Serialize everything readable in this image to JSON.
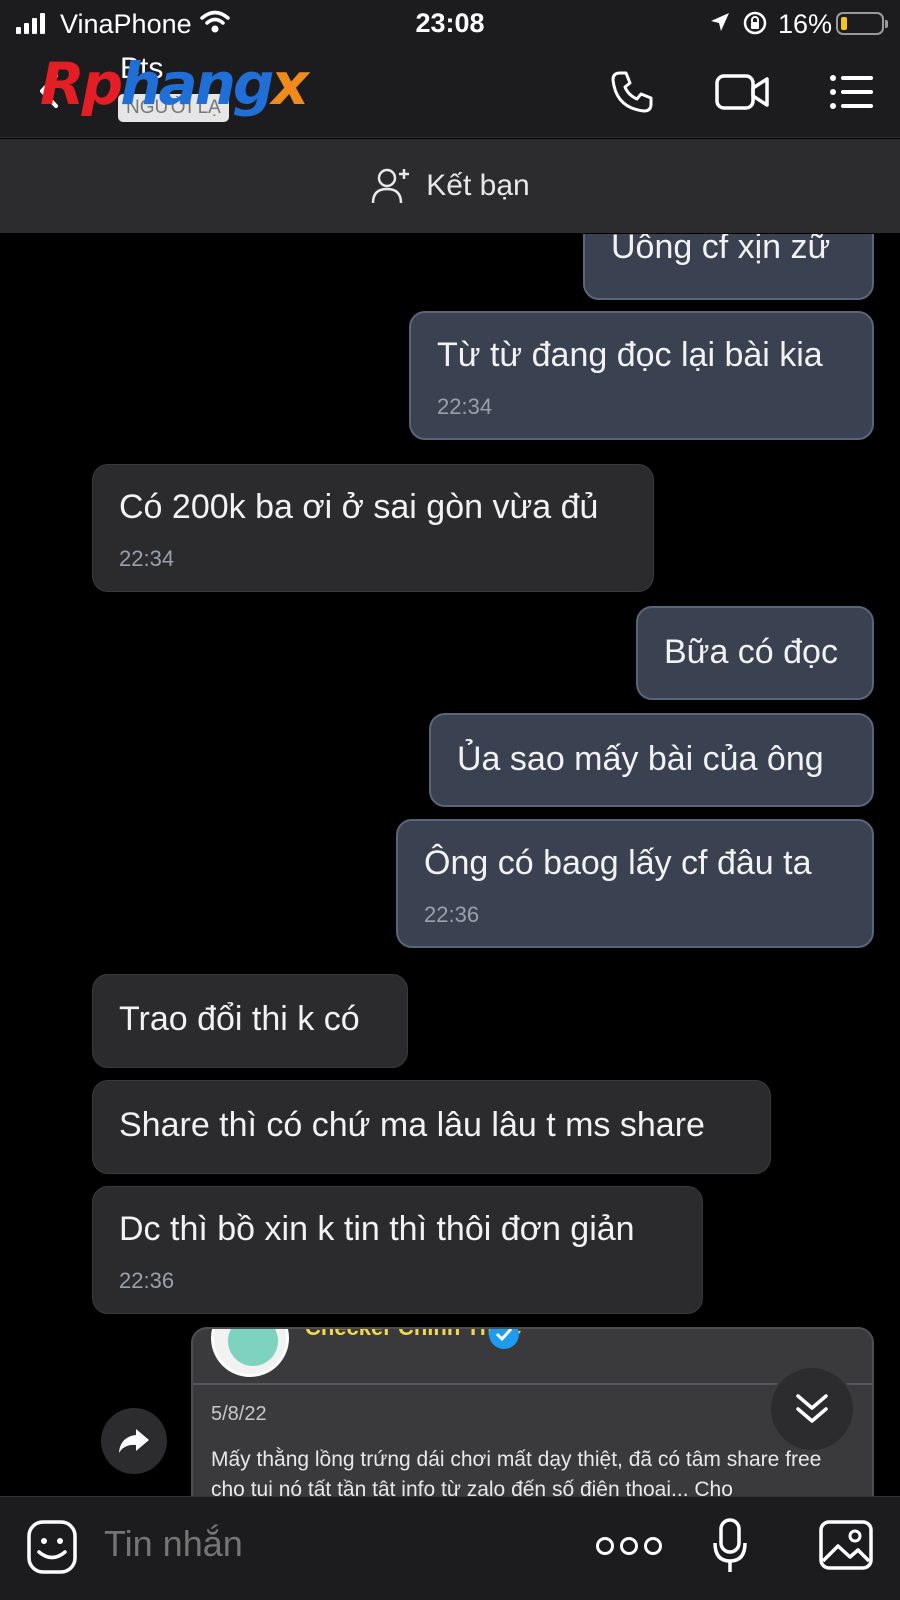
{
  "status_bar": {
    "carrier": "VinaPhone",
    "time": "23:08",
    "battery_percent": "16%",
    "battery_level": 0.16,
    "battery_color": "#f5c518"
  },
  "header": {
    "contact_name": "Bts",
    "stranger_badge": "NGƯỜI LẠ",
    "watermark": {
      "part1": "Rp",
      "part2": "hang",
      "part3": "x"
    },
    "icons": [
      "back-icon",
      "phone-icon",
      "video-call-icon",
      "menu-list-icon"
    ]
  },
  "add_friend": {
    "label": "Kết bạn",
    "icon": "add-friend-icon"
  },
  "messages": [
    {
      "direction": "out",
      "text": "Uông cf xịn zữ",
      "time": ""
    },
    {
      "direction": "out",
      "text": "Từ từ đang đọc lại bài kia",
      "time": "22:34"
    },
    {
      "direction": "in",
      "text": "Có 200k ba ơi ở sai gòn vừa đủ",
      "time": "22:34"
    },
    {
      "direction": "out",
      "text": "Bữa có đọc",
      "time": ""
    },
    {
      "direction": "out",
      "text": "Ủa sao mấy bài của ông",
      "time": ""
    },
    {
      "direction": "out",
      "text": "Ông có baog lấy cf đâu ta",
      "time": "22:36"
    },
    {
      "direction": "in",
      "text": "Trao đổi thi k có",
      "time": ""
    },
    {
      "direction": "in",
      "text": "Share thì có chứ ma lâu lâu t ms share",
      "time": ""
    },
    {
      "direction": "in",
      "text": "Dc thì bồ xin k tin thì thôi đơn giản",
      "time": "22:36"
    }
  ],
  "shared_post": {
    "page_name": "Checker Chính Thức",
    "date": "5/8/22",
    "content": "Mấy thằng lồng trứng dái chơi mất dạy thiệt, đã có tâm share free cho tui nó tất tần tật info từ zalo đến số điện thoại... Cho"
  },
  "composer": {
    "placeholder": "Tin nhắn"
  },
  "colors": {
    "outgoing_bubble": "#3a4150",
    "incoming_bubble": "#2b2b2d",
    "background": "#000000"
  }
}
